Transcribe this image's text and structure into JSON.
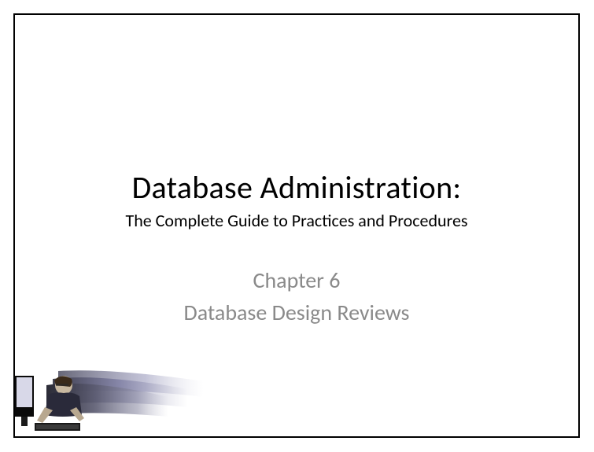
{
  "slide": {
    "main_title": "Database Administration:",
    "subtitle": "The Complete Guide to Practices and Procedures",
    "chapter_number": "Chapter 6",
    "chapter_title": "Database Design Reviews"
  }
}
